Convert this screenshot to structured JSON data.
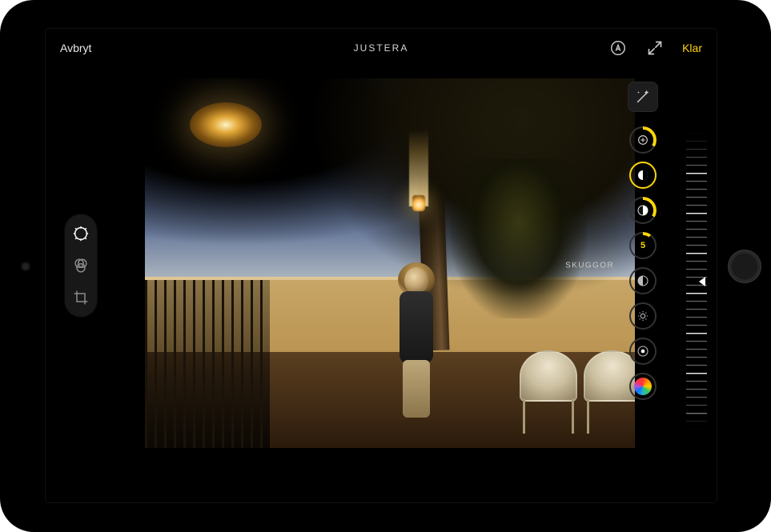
{
  "topbar": {
    "cancel": "Avbryt",
    "title": "JUSTERA",
    "done": "Klar"
  },
  "left_tabs": {
    "adjust": "adjust",
    "filters": "filters",
    "crop": "crop"
  },
  "adjust": {
    "label": "SKUGGOR",
    "value": "5",
    "tools": {
      "magic": "auto-enhance",
      "exposure": "exposure",
      "brilliance": "brilliance",
      "highlights": "highlights",
      "shadows": "shadows",
      "contrast": "contrast",
      "brightness": "brightness",
      "blackpoint": "black-point",
      "saturation": "saturation"
    }
  },
  "slider": {
    "value": 5,
    "min": -100,
    "max": 100
  }
}
